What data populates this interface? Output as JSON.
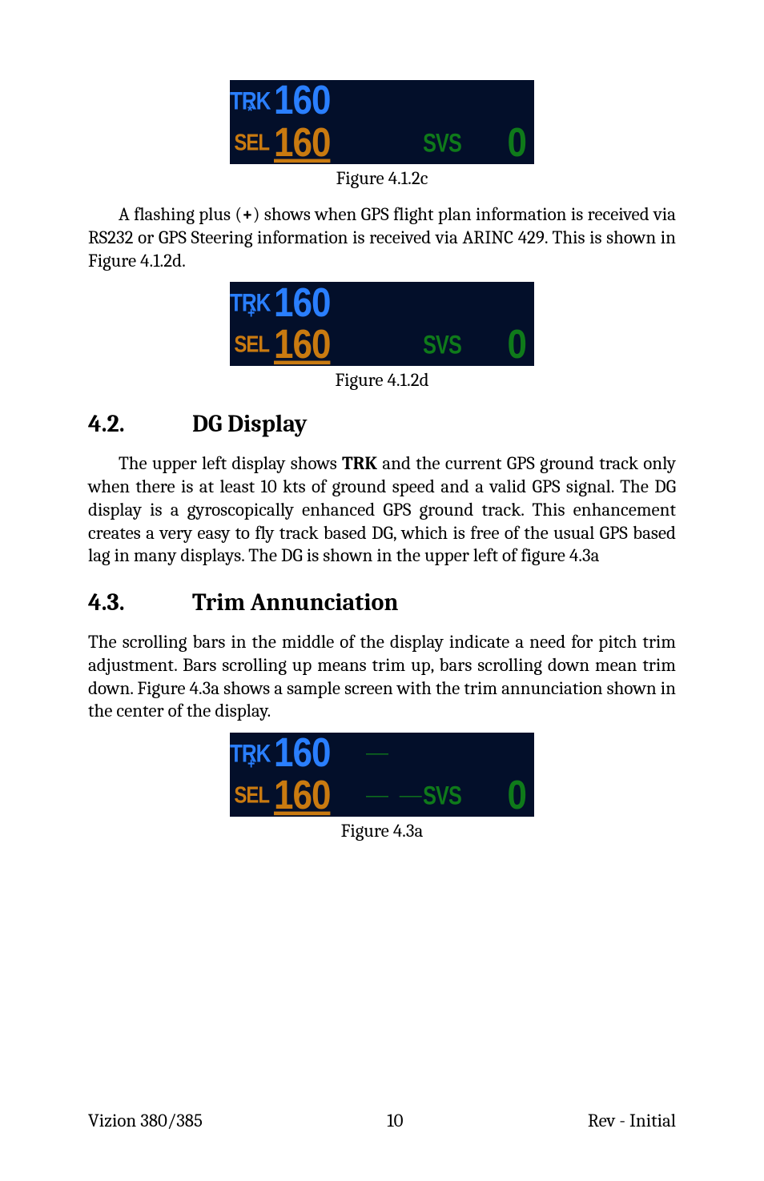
{
  "fig1": {
    "trk_label": "TRK",
    "trk_symbol": "*",
    "trk_value": "160",
    "sel_label": "SEL",
    "sel_value": "160",
    "svs_label": "SVS",
    "svs_value": "0",
    "caption": "Figure 4.1.2c"
  },
  "para1": "A flashing plus (+) shows when GPS flight plan information is received via RS232 or GPS Steering information is received via ARINC 429.  This is shown in Figure 4.1.2d.",
  "fig2": {
    "trk_label": "TRK",
    "trk_symbol": "+",
    "trk_value": "160",
    "sel_label": "SEL",
    "sel_value": "160",
    "svs_label": "SVS",
    "svs_value": "0",
    "caption": "Figure 4.1.2d"
  },
  "h1_num": "4.2.",
  "h1_title": "DG Display",
  "para2": "The upper left display shows TRK and the current GPS ground track only when there is at least 10 kts of ground speed and a valid GPS signal.  The DG display is a gyroscopically enhanced GPS ground track.  This enhancement creates a very easy to fly track based DG, which is free of the usual GPS based lag in many displays.  The DG is shown in the upper left of figure 4.3a",
  "h2_num": "4.3.",
  "h2_title": "Trim Annunciation",
  "para3": "The scrolling bars in the middle of the display indicate a need for pitch trim adjustment.  Bars scrolling up means trim up, bars scrolling down mean trim down.  Figure 4.3a shows a sample screen with the trim annunciation shown in the center of the display.",
  "fig3": {
    "trk_label": "TRK",
    "trk_symbol": "+",
    "trk_value": "160",
    "trim_top": "—",
    "trim_bot": "— —",
    "sel_label": "SEL",
    "sel_value": "160",
    "svs_label": "SVS",
    "svs_value": "0",
    "caption": "Figure 4.3a"
  },
  "footer": {
    "left": "Vizion 380/385",
    "center": "10",
    "right": "Rev - Initial"
  }
}
